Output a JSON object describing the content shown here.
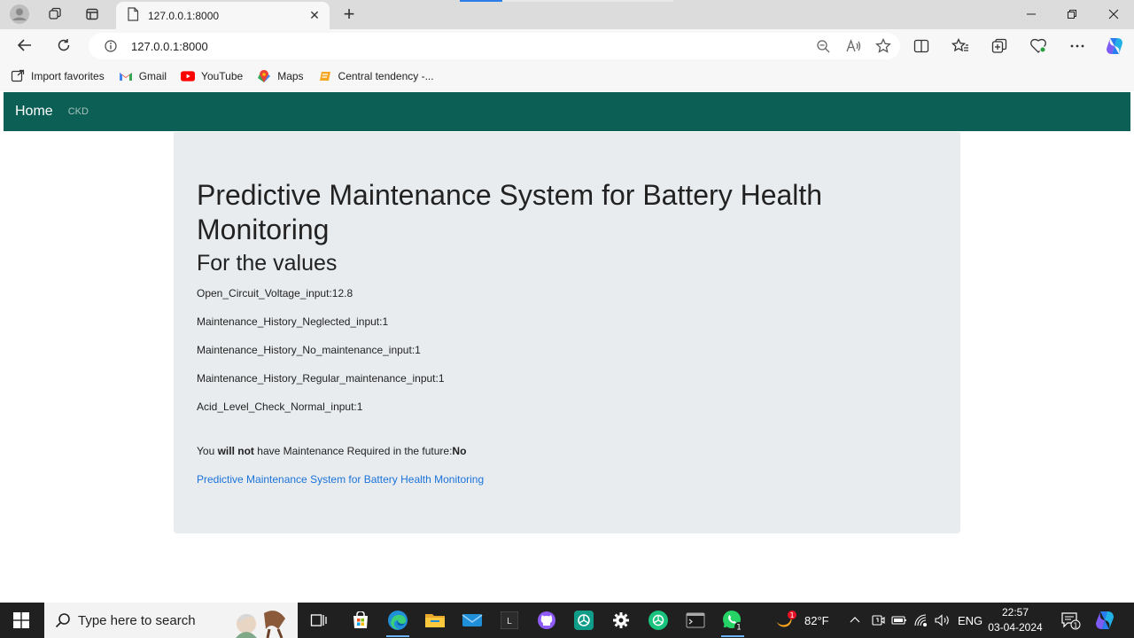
{
  "browser": {
    "tab_title": "127.0.0.1:8000",
    "address": "127.0.0.1:8000",
    "favorites": [
      {
        "label": "Import favorites",
        "icon": "import-favorites-icon"
      },
      {
        "label": "Gmail",
        "icon": "gmail-icon"
      },
      {
        "label": "YouTube",
        "icon": "youtube-icon"
      },
      {
        "label": "Maps",
        "icon": "maps-icon"
      },
      {
        "label": "Central tendency -...",
        "icon": "bookmark-page-icon"
      }
    ]
  },
  "navbar": {
    "home_label": "Home",
    "ckd_label": "CKD",
    "background": "#0b5f55"
  },
  "main": {
    "title": "Predictive Maintenance System for Battery Health Monitoring",
    "subtitle": "For the values",
    "values": [
      "Open_Circuit_Voltage_input:12.8",
      "Maintenance_History_Neglected_input:1",
      "Maintenance_History_No_maintenance_input:1",
      "Maintenance_History_Regular_maintenance_input:1",
      "Acid_Level_Check_Normal_input:1"
    ],
    "result": {
      "prefix": "You",
      "emphasis": "will not",
      "middle": "have Maintenance Required in the future:",
      "answer": "No"
    },
    "link_text": "Predictive Maintenance System for Battery Health Monitoring",
    "link_color": "#1a73d9"
  },
  "taskbar": {
    "search_placeholder": "Type here to search",
    "weather_temp": "82°F",
    "weather_badge": "1",
    "whatsapp_badge": "1",
    "notification_badge": "1",
    "language": "ENG",
    "time": "22:57",
    "date": "03-04-2024"
  }
}
